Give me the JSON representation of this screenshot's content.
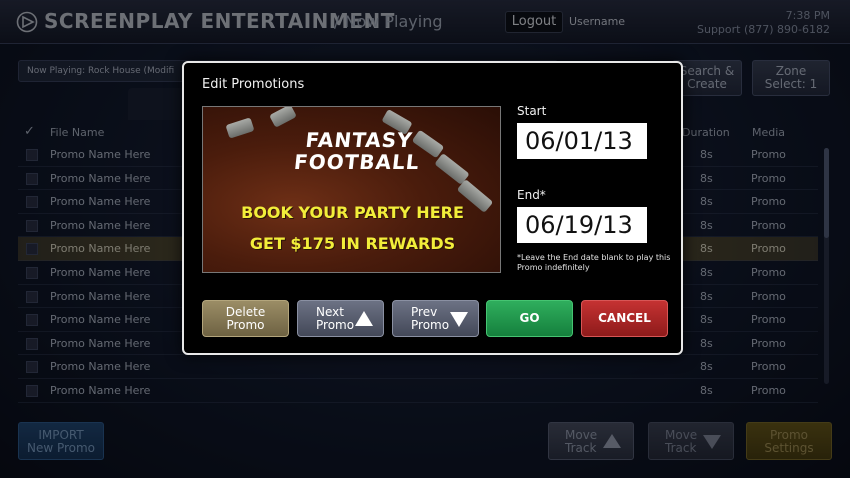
{
  "app": {
    "brand": "SCREENPLAY ENTERTAINMENT",
    "section": "/ Now Playing",
    "logout_label": "Logout",
    "username": "Username",
    "clock": "7:38 PM",
    "support": "Support (877) 890-6182"
  },
  "toolbar": {
    "now_playing": "Now Playing:  Rock House (Modifi",
    "search_line1": "Search &",
    "search_line2": "Create",
    "zone_line1": "Zone",
    "zone_line2": "Select: 1"
  },
  "table": {
    "headers": {
      "file_name": "File Name",
      "duration": "Duration",
      "media": "Media"
    },
    "rows": [
      {
        "name": "Promo Name Here",
        "duration": "8s",
        "media": "Promo"
      },
      {
        "name": "Promo Name Here",
        "duration": "8s",
        "media": "Promo"
      },
      {
        "name": "Promo Name Here",
        "duration": "8s",
        "media": "Promo"
      },
      {
        "name": "Promo Name Here",
        "duration": "8s",
        "media": "Promo"
      },
      {
        "name": "Promo Name Here",
        "duration": "8s",
        "media": "Promo",
        "selected": true
      },
      {
        "name": "Promo Name Here",
        "duration": "8s",
        "media": "Promo"
      },
      {
        "name": "Promo Name Here",
        "duration": "8s",
        "media": "Promo"
      },
      {
        "name": "Promo Name Here",
        "duration": "8s",
        "media": "Promo"
      },
      {
        "name": "Promo Name Here",
        "duration": "8s",
        "media": "Promo"
      },
      {
        "name": "Promo Name Here",
        "duration": "8s",
        "media": "Promo"
      },
      {
        "name": "Promo Name Here",
        "duration": "8s",
        "media": "Promo"
      }
    ]
  },
  "bottom": {
    "import_line1": "IMPORT",
    "import_line2": "New Promo",
    "move_up_line1": "Move",
    "move_up_line2": "Track",
    "move_down_line1": "Move",
    "move_down_line2": "Track",
    "settings_line1": "Promo",
    "settings_line2": "Settings"
  },
  "modal": {
    "title": "Edit Promotions",
    "promo_image": {
      "title_line1": "FANTASY",
      "title_line2": "FOOTBALL",
      "line1": "BOOK YOUR PARTY HERE",
      "line2": "GET $175 IN REWARDS"
    },
    "start_label": "Start",
    "start_value": "06/01/13",
    "end_label": "End*",
    "end_value": "06/19/13",
    "end_note": "*Leave the End date blank to play this Promo indefinitely",
    "buttons": {
      "delete_line1": "Delete",
      "delete_line2": "Promo",
      "next_line1": "Next",
      "next_line2": "Promo",
      "prev_line1": "Prev",
      "prev_line2": "Promo",
      "go": "GO",
      "cancel": "CANCEL"
    }
  },
  "colors": {
    "go": "#1f9a4c",
    "cancel": "#b22a2a",
    "delete": "#8a7d57",
    "selected_row": "#6a5e36"
  },
  "icons": [
    "logo-mark-icon",
    "checkmark-icon",
    "triangle-up-icon",
    "triangle-down-icon"
  ]
}
